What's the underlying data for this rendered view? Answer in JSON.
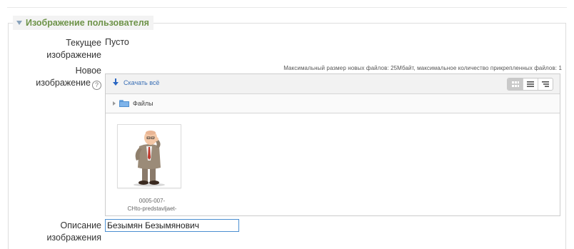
{
  "section": {
    "title": "Изображение пользователя"
  },
  "current_image": {
    "label_line1": "Текущее",
    "label_line2": "изображение",
    "value": "Пусто"
  },
  "new_image": {
    "label_line1": "Новое",
    "label_line2": "изображение",
    "help_glyph": "?",
    "limits_text": "Максимальный размер новых файлов: 25Мбайт, максимальное количество прикрепленных файлов: 1"
  },
  "filemanager": {
    "download_all_label": "Скачать всё",
    "path_folder": "Файлы",
    "view_buttons": [
      "icons-view",
      "list-view",
      "tree-view"
    ],
    "file": {
      "name_line1": "0005-007-",
      "name_line2": "CHto-predstavljaet-"
    }
  },
  "description": {
    "label_line1": "Описание",
    "label_line2": "изображения",
    "value": "Безымян Безымянович"
  },
  "colors": {
    "section_title": "#6e9349",
    "link": "#3a6fb5",
    "input_border": "#4b8fd1"
  }
}
